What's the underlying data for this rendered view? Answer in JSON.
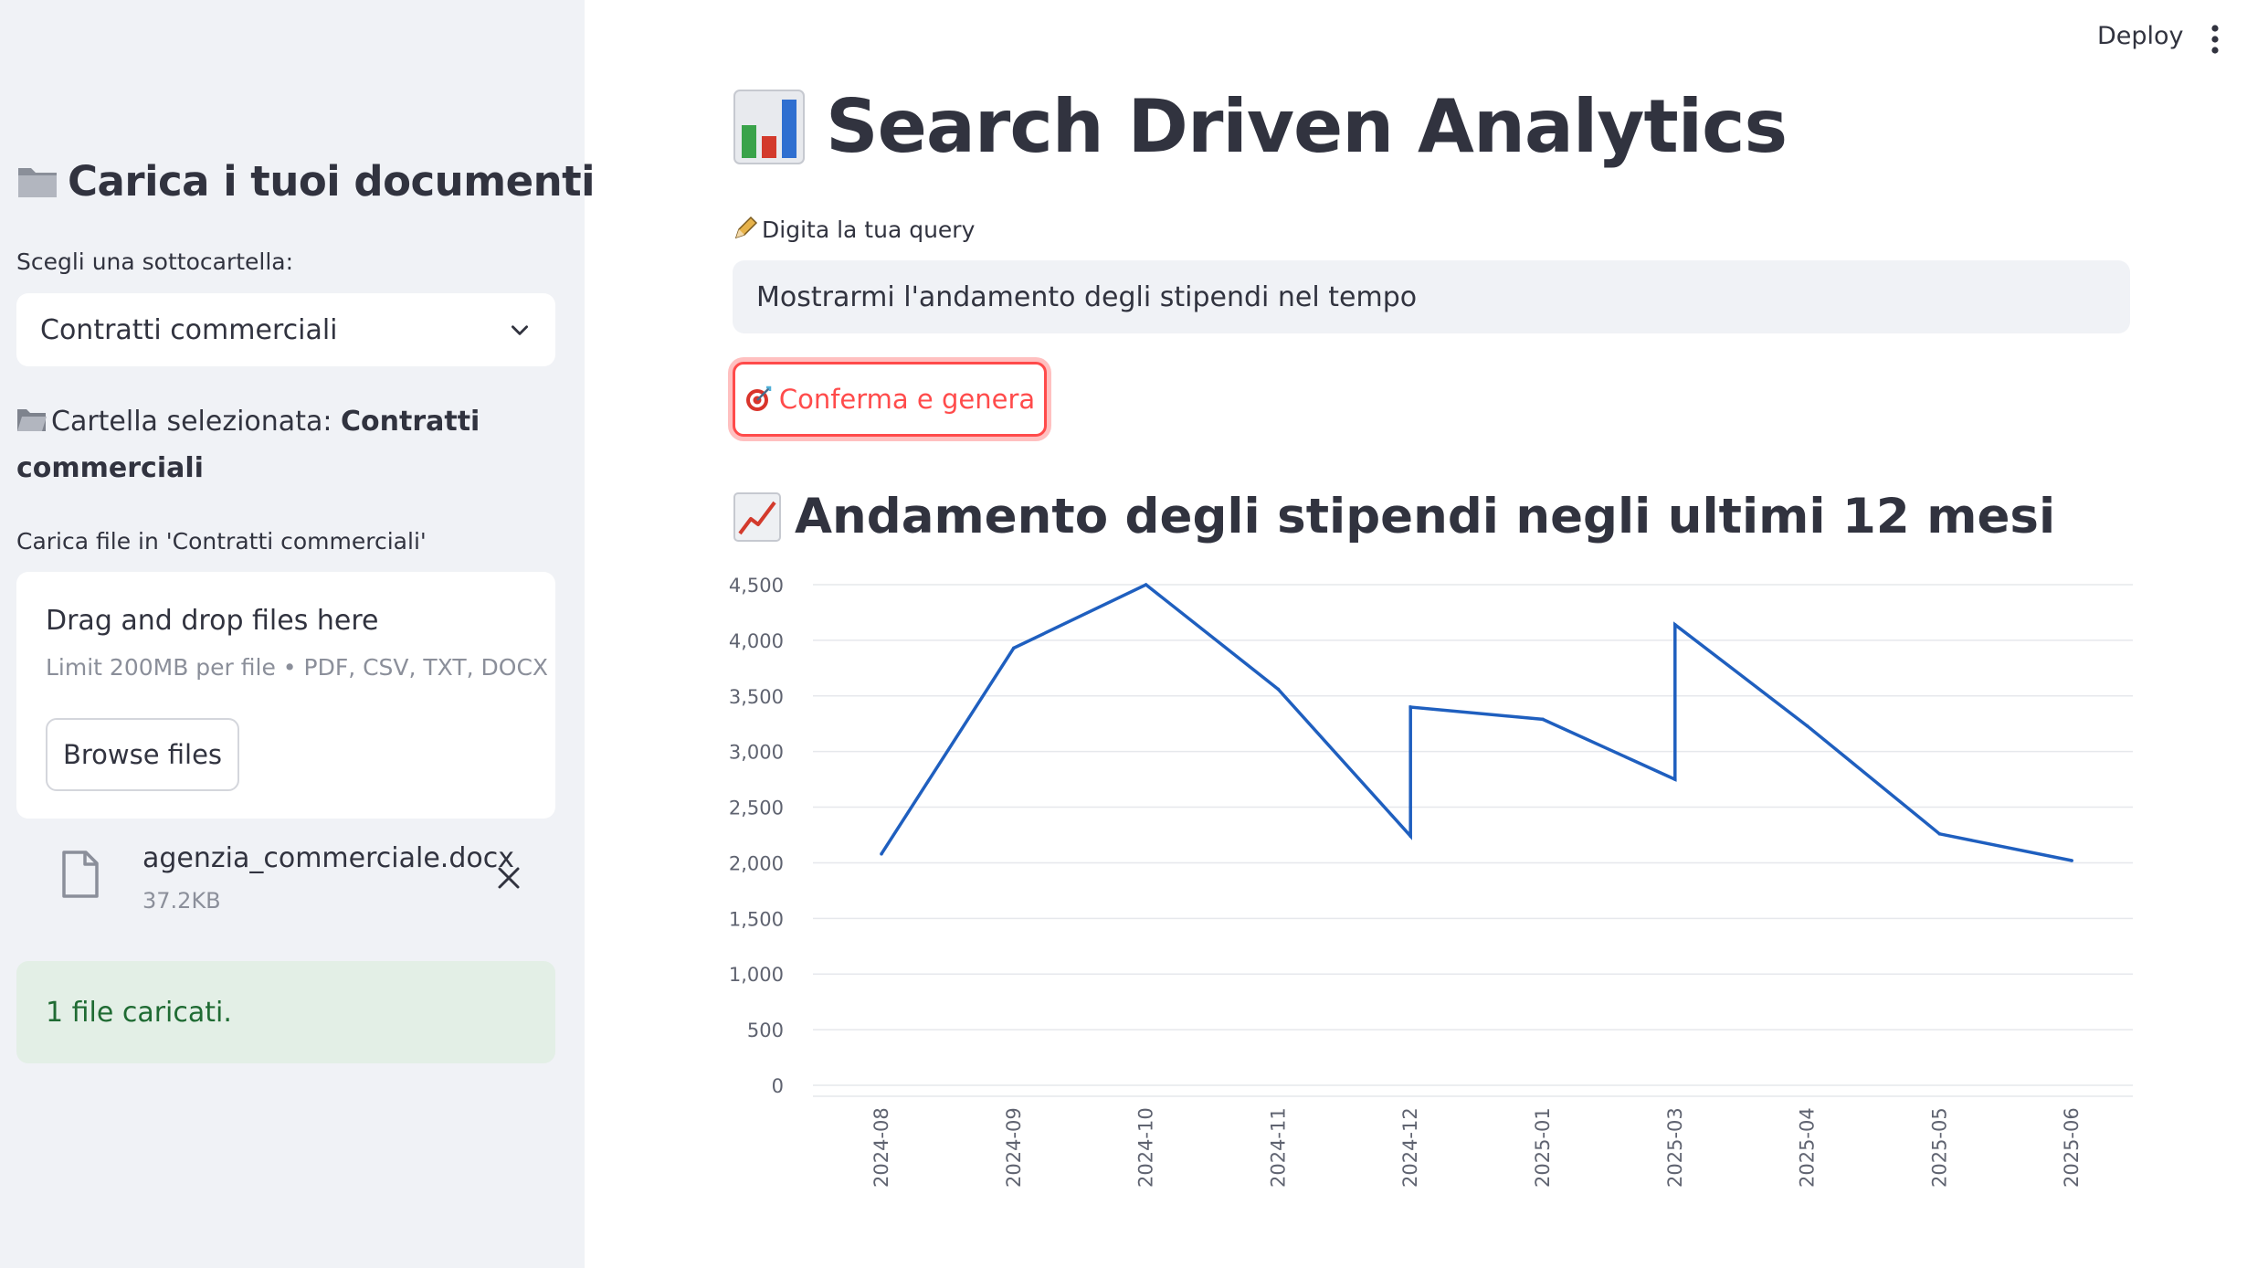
{
  "header": {
    "deploy_label": "Deploy"
  },
  "sidebar": {
    "title": "Carica i tuoi documenti",
    "subfolder_label": "Scegli una sottocartella:",
    "subfolder_selected": "Contratti commerciali",
    "selected_folder_prefix": "Cartella selezionata:",
    "selected_folder_name": "Contratti commerciali",
    "upload_label": "Carica file in 'Contratti commerciali'",
    "dropzone": {
      "title": "Drag and drop files here",
      "limit": "Limit 200MB per file • PDF, CSV, TXT, DOCX",
      "browse_label": "Browse files"
    },
    "uploaded_file": {
      "name": "agenzia_commerciale.docx",
      "size": "37.2KB"
    },
    "success_message": "1 file caricati."
  },
  "main": {
    "title": "Search Driven Analytics",
    "query_label": "Digita la tua query",
    "query_value": "Mostrarmi l'andamento degli stipendi nel tempo",
    "confirm_label": "Conferma e genera",
    "chart_title": "Andamento degli stipendi negli ultimi 12 mesi"
  },
  "colors": {
    "accent": "#ff4b4b",
    "line": "#1f5fbf",
    "success_bg": "#e3efe6",
    "success_text": "#1f6b33"
  },
  "chart_data": {
    "type": "line",
    "title": "Andamento degli stipendi negli ultimi 12 mesi",
    "xlabel": "",
    "ylabel": "",
    "ylim": [
      0,
      4500
    ],
    "y_ticks": [
      0,
      500,
      1000,
      1500,
      2000,
      2500,
      3000,
      3500,
      4000,
      4500
    ],
    "y_tick_labels": [
      "0",
      "500",
      "1,000",
      "1,500",
      "2,000",
      "2,500",
      "3,000",
      "3,500",
      "4,000",
      "4,500"
    ],
    "categories": [
      "2024-08",
      "2024-09",
      "2024-10",
      "2024-11",
      "2024-12",
      "2025-01",
      "2025-03",
      "2025-04",
      "2025-05",
      "2025-06"
    ],
    "points": [
      {
        "x": "2024-08",
        "y": 2080
      },
      {
        "x": "2024-09",
        "y": 3930
      },
      {
        "x": "2024-10",
        "y": 4500
      },
      {
        "x": "2024-11",
        "y": 3560
      },
      {
        "x": "2024-12",
        "y": 2240
      },
      {
        "x": "2024-12",
        "y": 3400
      },
      {
        "x": "2025-01",
        "y": 3290
      },
      {
        "x": "2025-03",
        "y": 2750
      },
      {
        "x": "2025-03",
        "y": 4140
      },
      {
        "x": "2025-04",
        "y": 3230
      },
      {
        "x": "2025-05",
        "y": 2260
      },
      {
        "x": "2025-06",
        "y": 2020
      }
    ],
    "grid": true,
    "legend": "none"
  }
}
